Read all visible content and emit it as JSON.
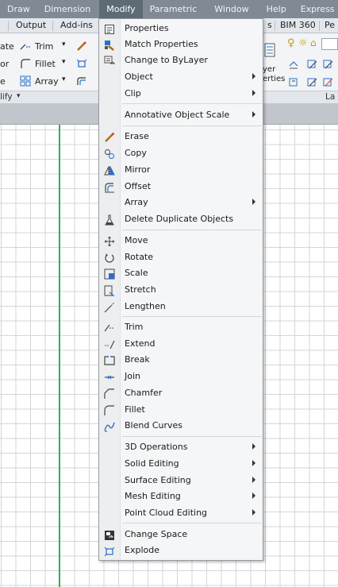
{
  "menubar": {
    "items": [
      "Draw",
      "Dimension",
      "Modify",
      "Parametric",
      "Window",
      "Help",
      "Express"
    ],
    "active": "Modify"
  },
  "ribbon_tabs": [
    "Output",
    "Add-ins",
    "s",
    "BIM 360",
    "Pe"
  ],
  "ribbon": {
    "left_fragments": [
      "ate",
      "or",
      "e"
    ],
    "trim": "Trim",
    "fillet": "Fillet",
    "array": "Array",
    "panel_label": "lify",
    "layer_text_1": "yer",
    "layer_text_2": "erties",
    "right_panel_label": "La"
  },
  "menu": {
    "items": [
      {
        "label": "Properties",
        "icon": "properties-icon"
      },
      {
        "label": "Match Properties",
        "icon": "match-properties-icon"
      },
      {
        "label": "Change to ByLayer",
        "icon": "change-bylayer-icon"
      },
      {
        "label": "Object",
        "submenu": true
      },
      {
        "label": "Clip",
        "submenu": true
      },
      {
        "label": "Annotative Object Scale",
        "submenu": true
      },
      {
        "label": "Erase",
        "icon": "eraser-icon"
      },
      {
        "label": "Copy",
        "icon": "copy-icon"
      },
      {
        "label": "Mirror",
        "icon": "mirror-icon"
      },
      {
        "label": "Offset",
        "icon": "offset-icon"
      },
      {
        "label": "Array",
        "submenu": true
      },
      {
        "label": "Delete Duplicate Objects",
        "icon": "delete-duplicates-icon"
      },
      {
        "label": "Move",
        "icon": "move-icon"
      },
      {
        "label": "Rotate",
        "icon": "rotate-icon"
      },
      {
        "label": "Scale",
        "icon": "scale-icon"
      },
      {
        "label": "Stretch",
        "icon": "stretch-icon"
      },
      {
        "label": "Lengthen",
        "icon": "lengthen-icon"
      },
      {
        "label": "Trim",
        "icon": "trim-icon"
      },
      {
        "label": "Extend",
        "icon": "extend-icon"
      },
      {
        "label": "Break",
        "icon": "break-icon"
      },
      {
        "label": "Join",
        "icon": "join-icon"
      },
      {
        "label": "Chamfer",
        "icon": "chamfer-icon"
      },
      {
        "label": "Fillet",
        "icon": "fillet-icon"
      },
      {
        "label": "Blend Curves",
        "icon": "blend-curves-icon"
      },
      {
        "label": "3D Operations",
        "submenu": true
      },
      {
        "label": "Solid Editing",
        "submenu": true
      },
      {
        "label": "Surface Editing",
        "submenu": true
      },
      {
        "label": "Mesh Editing",
        "submenu": true
      },
      {
        "label": "Point Cloud Editing",
        "submenu": true
      },
      {
        "label": "Change Space",
        "icon": "change-space-icon"
      },
      {
        "label": "Explode",
        "icon": "explode-icon"
      }
    ]
  }
}
